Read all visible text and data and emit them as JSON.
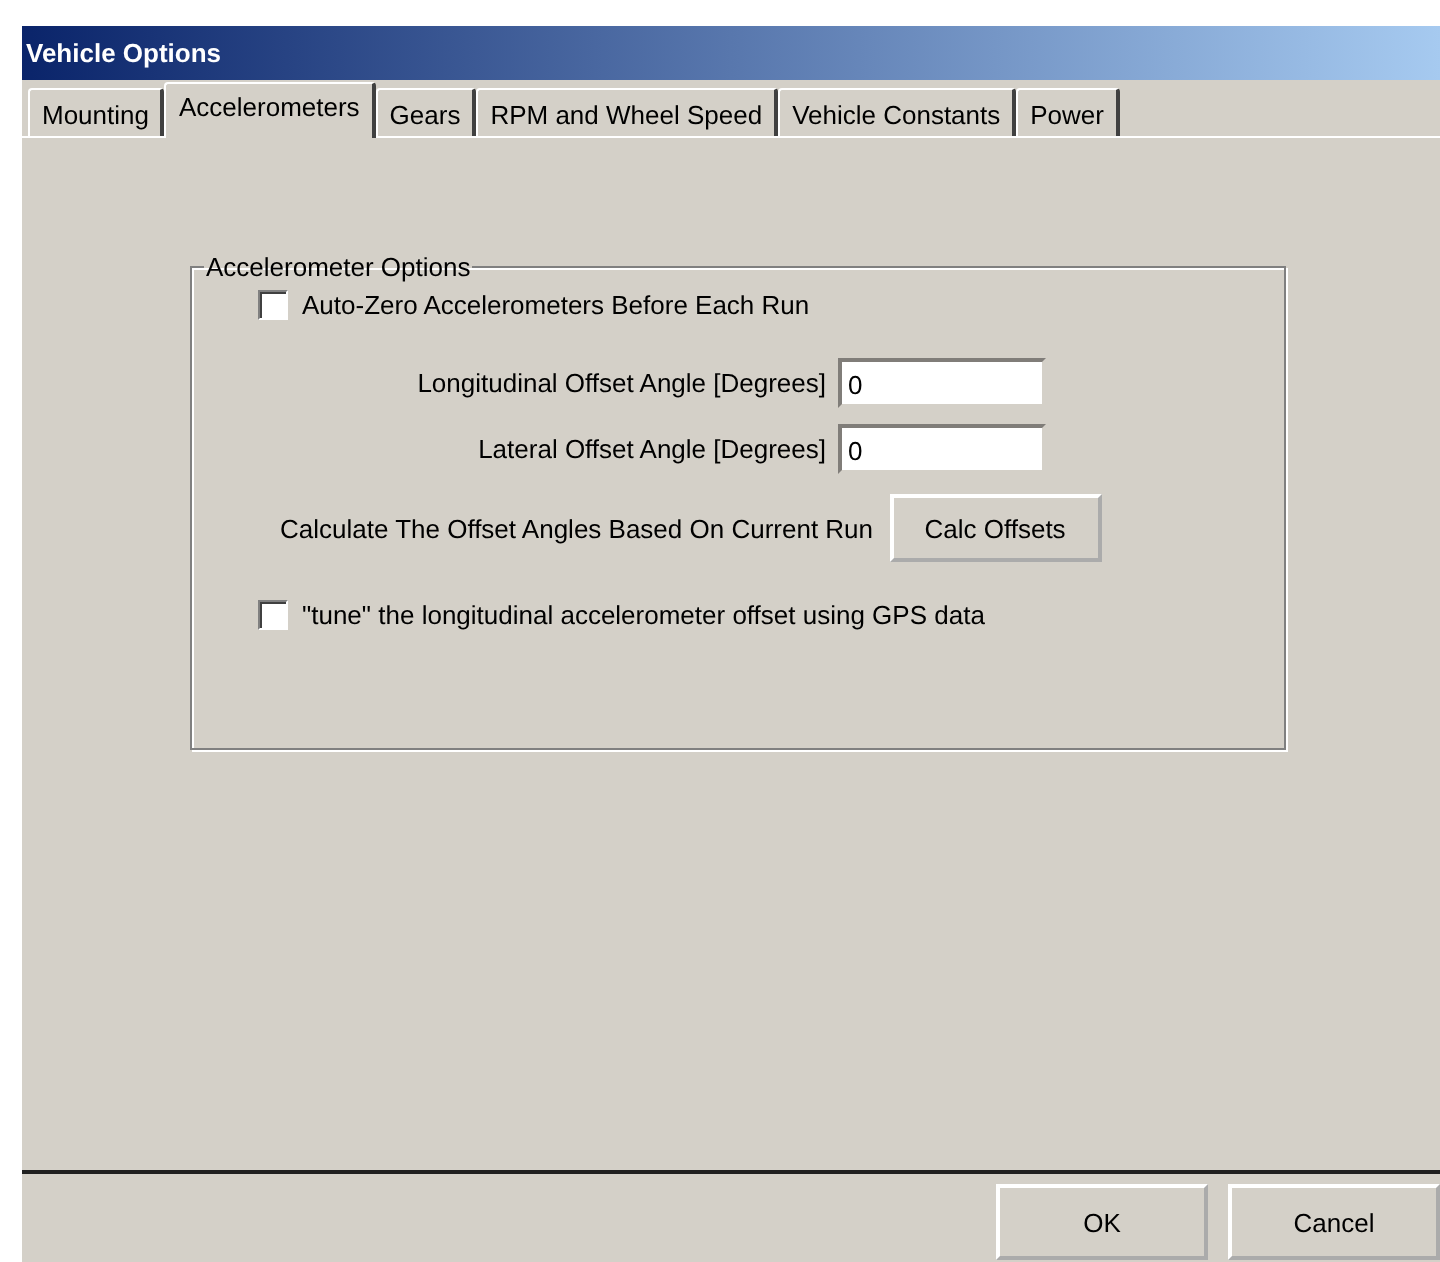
{
  "window": {
    "title": "Vehicle Options"
  },
  "tabs": [
    {
      "label": "Mounting",
      "selected": false
    },
    {
      "label": "Accelerometers",
      "selected": true
    },
    {
      "label": "Gears",
      "selected": false
    },
    {
      "label": "RPM and Wheel Speed",
      "selected": false
    },
    {
      "label": "Vehicle Constants",
      "selected": false
    },
    {
      "label": "Power",
      "selected": false
    }
  ],
  "group": {
    "title": "Accelerometer Options",
    "auto_zero": {
      "label": "Auto-Zero Accelerometers Before Each Run",
      "checked": false
    },
    "fields": [
      {
        "label": "Longitudinal Offset Angle [Degrees]",
        "value": "0"
      },
      {
        "label": "Lateral Offset Angle [Degrees]",
        "value": "0"
      }
    ],
    "calc": {
      "label": "Calculate The Offset Angles Based On Current Run",
      "button": "Calc Offsets"
    },
    "tune": {
      "label": "\"tune\" the longitudinal accelerometer offset using GPS data",
      "checked": false
    }
  },
  "buttons": [
    "OK",
    "Cancel"
  ]
}
